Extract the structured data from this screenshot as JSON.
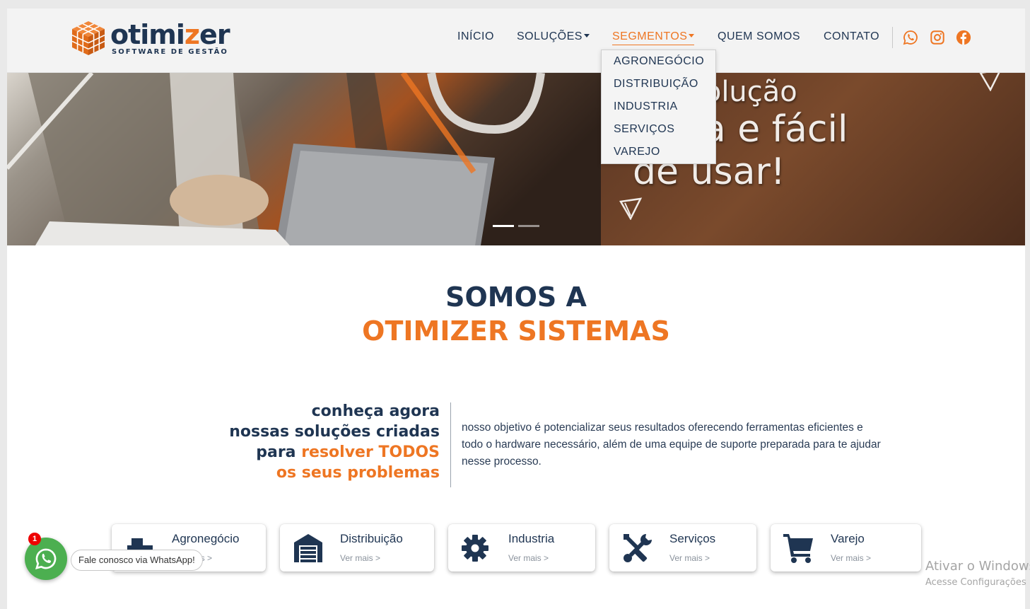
{
  "brand": {
    "logo_word_part1": "otimi",
    "logo_word_part2": "z",
    "logo_word_part3": "er",
    "tagline": "SOFTWARE DE GESTÃO",
    "colors": {
      "navy": "#1f3552",
      "orange": "#ee7623",
      "whatsapp_green": "#4caf50"
    }
  },
  "nav": {
    "items": [
      {
        "label": "INÍCIO"
      },
      {
        "label": "SOLUÇÕES"
      },
      {
        "label": "SEGMENTOS"
      },
      {
        "label": "QUEM SOMOS"
      },
      {
        "label": "CONTATO"
      }
    ],
    "active": "SEGMENTOS",
    "social_icons": [
      "whatsapp-icon",
      "instagram-icon",
      "facebook-icon"
    ]
  },
  "dropdown": {
    "items": [
      "AGRONEGÓCIO",
      "DISTRIBUIÇÃO",
      "INDUSTRIA",
      "SERVIÇOS",
      "VAREJO"
    ]
  },
  "hero": {
    "line1": "solução",
    "line2": "pleta e fácil",
    "line3": "de usar!",
    "slides_total": 2,
    "slide_active": 1
  },
  "about": {
    "title_line1": "SOMOS A",
    "title_line2": "OTIMIZER SISTEMAS",
    "left_line1": "conheça agora",
    "left_line2": "nossas soluções criadas",
    "left_line3_prefix": "para ",
    "left_line3_highlight": "resolver TODOS",
    "left_line4": "os seus problemas",
    "right_text": "nosso objetivo é potencializar seus resultados oferecendo ferramentas eficientes e todo o hardware necessário, além de uma equipe de suporte preparada para te ajudar nesse processo."
  },
  "segments": [
    {
      "title": "Agronegócio",
      "more": "Ver mais >",
      "icon": "tractor-icon"
    },
    {
      "title": "Distribuição",
      "more": "Ver mais >",
      "icon": "warehouse-icon"
    },
    {
      "title": "Industria",
      "more": "Ver mais >",
      "icon": "gear-icon"
    },
    {
      "title": "Serviços",
      "more": "Ver mais >",
      "icon": "tools-icon"
    },
    {
      "title": "Varejo",
      "more": "Ver mais >",
      "icon": "cart-icon"
    }
  ],
  "whatsapp_float": {
    "badge": "1",
    "label": "Fale conosco via WhatsApp!"
  },
  "os_watermark": {
    "line1": "Ativar o Windows",
    "line2": "Acesse Configurações"
  }
}
